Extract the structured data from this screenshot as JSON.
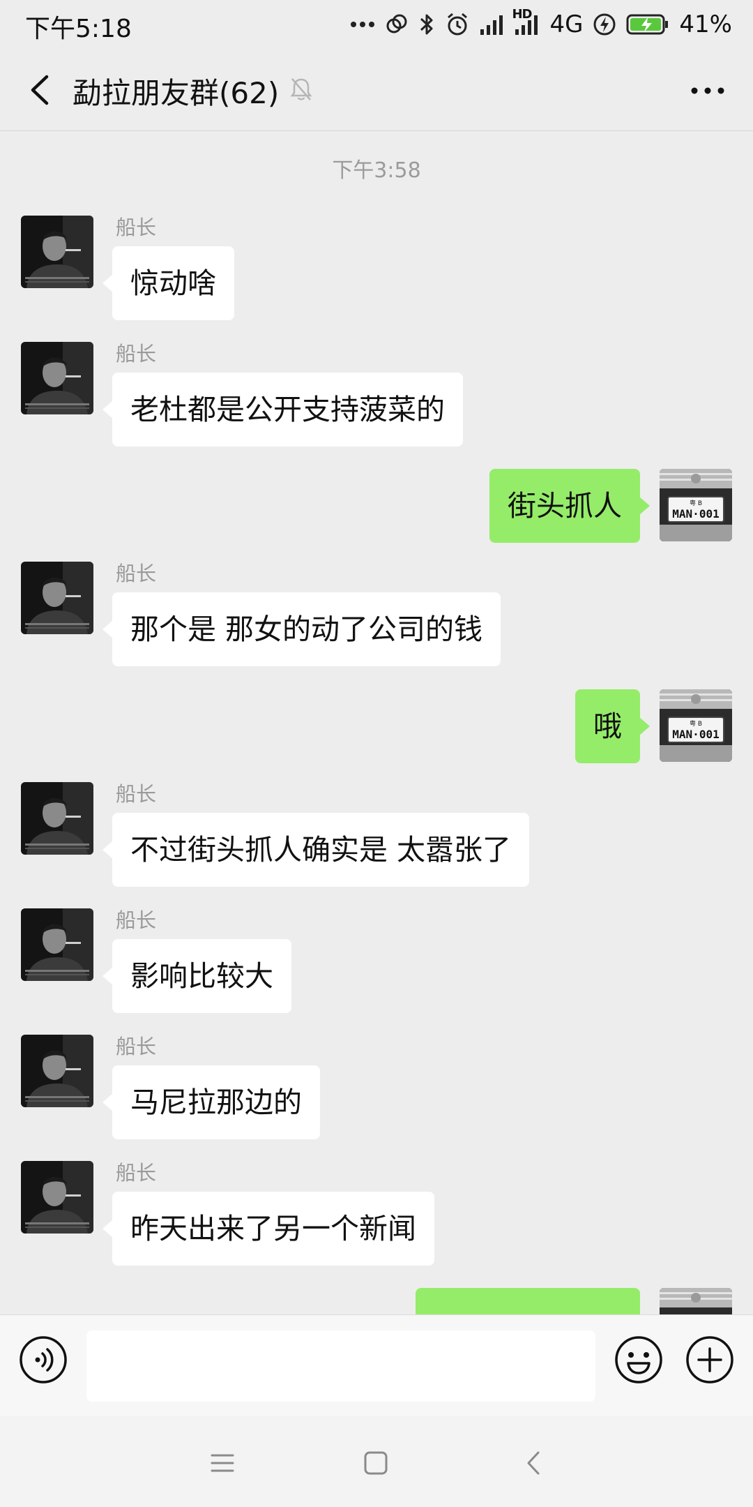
{
  "status_bar": {
    "time": "下午5:18",
    "hd_label": "HD",
    "network": "4G",
    "battery": "41%"
  },
  "nav": {
    "title": "勐拉朋友群(62)",
    "icons": {
      "back": "chevron-left-icon",
      "mute": "bell-muted-icon",
      "more": "more-horizontal-icon"
    }
  },
  "chat": {
    "timestamp": "下午3:58",
    "messages": [
      {
        "direction": "in",
        "sender": "船长",
        "text": "惊动啥"
      },
      {
        "direction": "in",
        "sender": "船长",
        "text": "老杜都是公开支持菠菜的"
      },
      {
        "direction": "out",
        "text": "街头抓人"
      },
      {
        "direction": "in",
        "sender": "船长",
        "text": "那个是 那女的动了公司的钱"
      },
      {
        "direction": "out",
        "text": "哦"
      },
      {
        "direction": "in",
        "sender": "船长",
        "text": "不过街头抓人确实是 太嚣张了"
      },
      {
        "direction": "in",
        "sender": "船长",
        "text": "影响比较大"
      },
      {
        "direction": "in",
        "sender": "船长",
        "text": "马尼拉那边的"
      },
      {
        "direction": "in",
        "sender": "船长",
        "text": "昨天出来了另一个新闻"
      }
    ],
    "my_avatar_plate": "MAN·001",
    "my_avatar_plate_top": "粤 B"
  },
  "input_bar": {
    "icons": {
      "voice": "voice-icon",
      "emoji": "emoji-icon",
      "plus": "plus-icon"
    }
  },
  "system_nav": {
    "icons": {
      "menu": "menu-icon",
      "home": "home-icon",
      "back": "back-icon"
    }
  },
  "colors": {
    "background": "#ededed",
    "outgoing_bubble": "#95ec69",
    "incoming_bubble": "#ffffff",
    "sender_name": "#9a9a9a"
  }
}
